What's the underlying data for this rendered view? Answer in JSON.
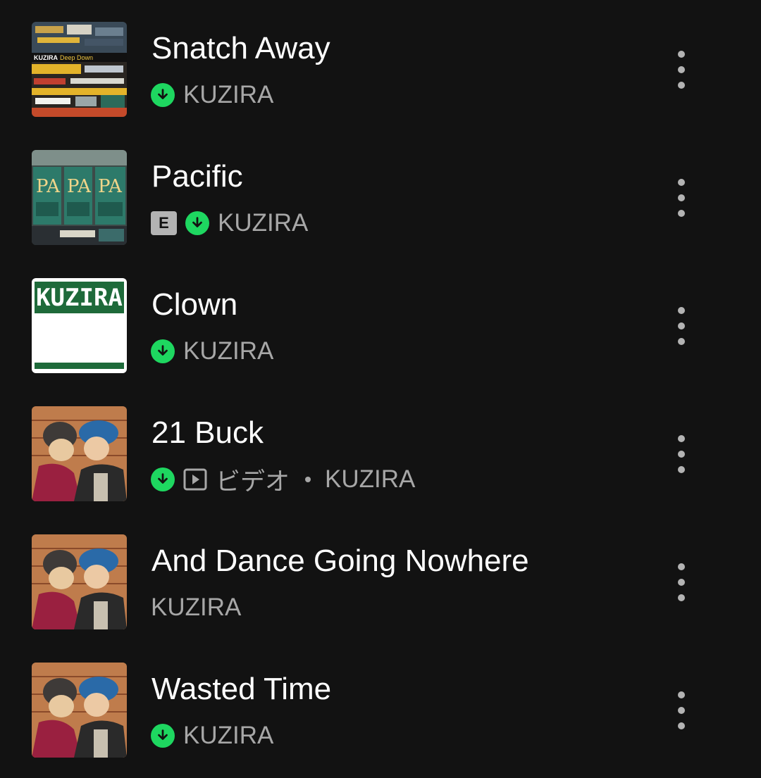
{
  "tracks": [
    {
      "title": "Snatch Away",
      "artist": "KUZIRA",
      "downloaded": true,
      "explicit": false,
      "video": false,
      "artwork_icon": "album-deep-down-icon"
    },
    {
      "title": "Pacific",
      "artist": "KUZIRA",
      "downloaded": true,
      "explicit": true,
      "explicit_label": "E",
      "video": false,
      "artwork_icon": "album-pacific-icon"
    },
    {
      "title": "Clown",
      "artist": "KUZIRA",
      "downloaded": true,
      "explicit": false,
      "video": false,
      "artwork_icon": "album-kuzira-icon",
      "artwork_text": "KUZIRA"
    },
    {
      "title": "21 Buck",
      "artist": "KUZIRA",
      "downloaded": true,
      "explicit": false,
      "video": true,
      "video_label": "ビデオ",
      "artwork_icon": "album-illustration-icon"
    },
    {
      "title": "And Dance Going Nowhere",
      "artist": "KUZIRA",
      "downloaded": false,
      "explicit": false,
      "video": false,
      "artwork_icon": "album-illustration-icon"
    },
    {
      "title": "Wasted Time",
      "artist": "KUZIRA",
      "downloaded": true,
      "explicit": false,
      "video": false,
      "artwork_icon": "album-illustration-icon"
    }
  ],
  "colors": {
    "background": "#121212",
    "title": "#ffffff",
    "subtitle": "#a7a7a7",
    "download_accent": "#1ed760",
    "explicit_badge": "#b3b3b3"
  }
}
